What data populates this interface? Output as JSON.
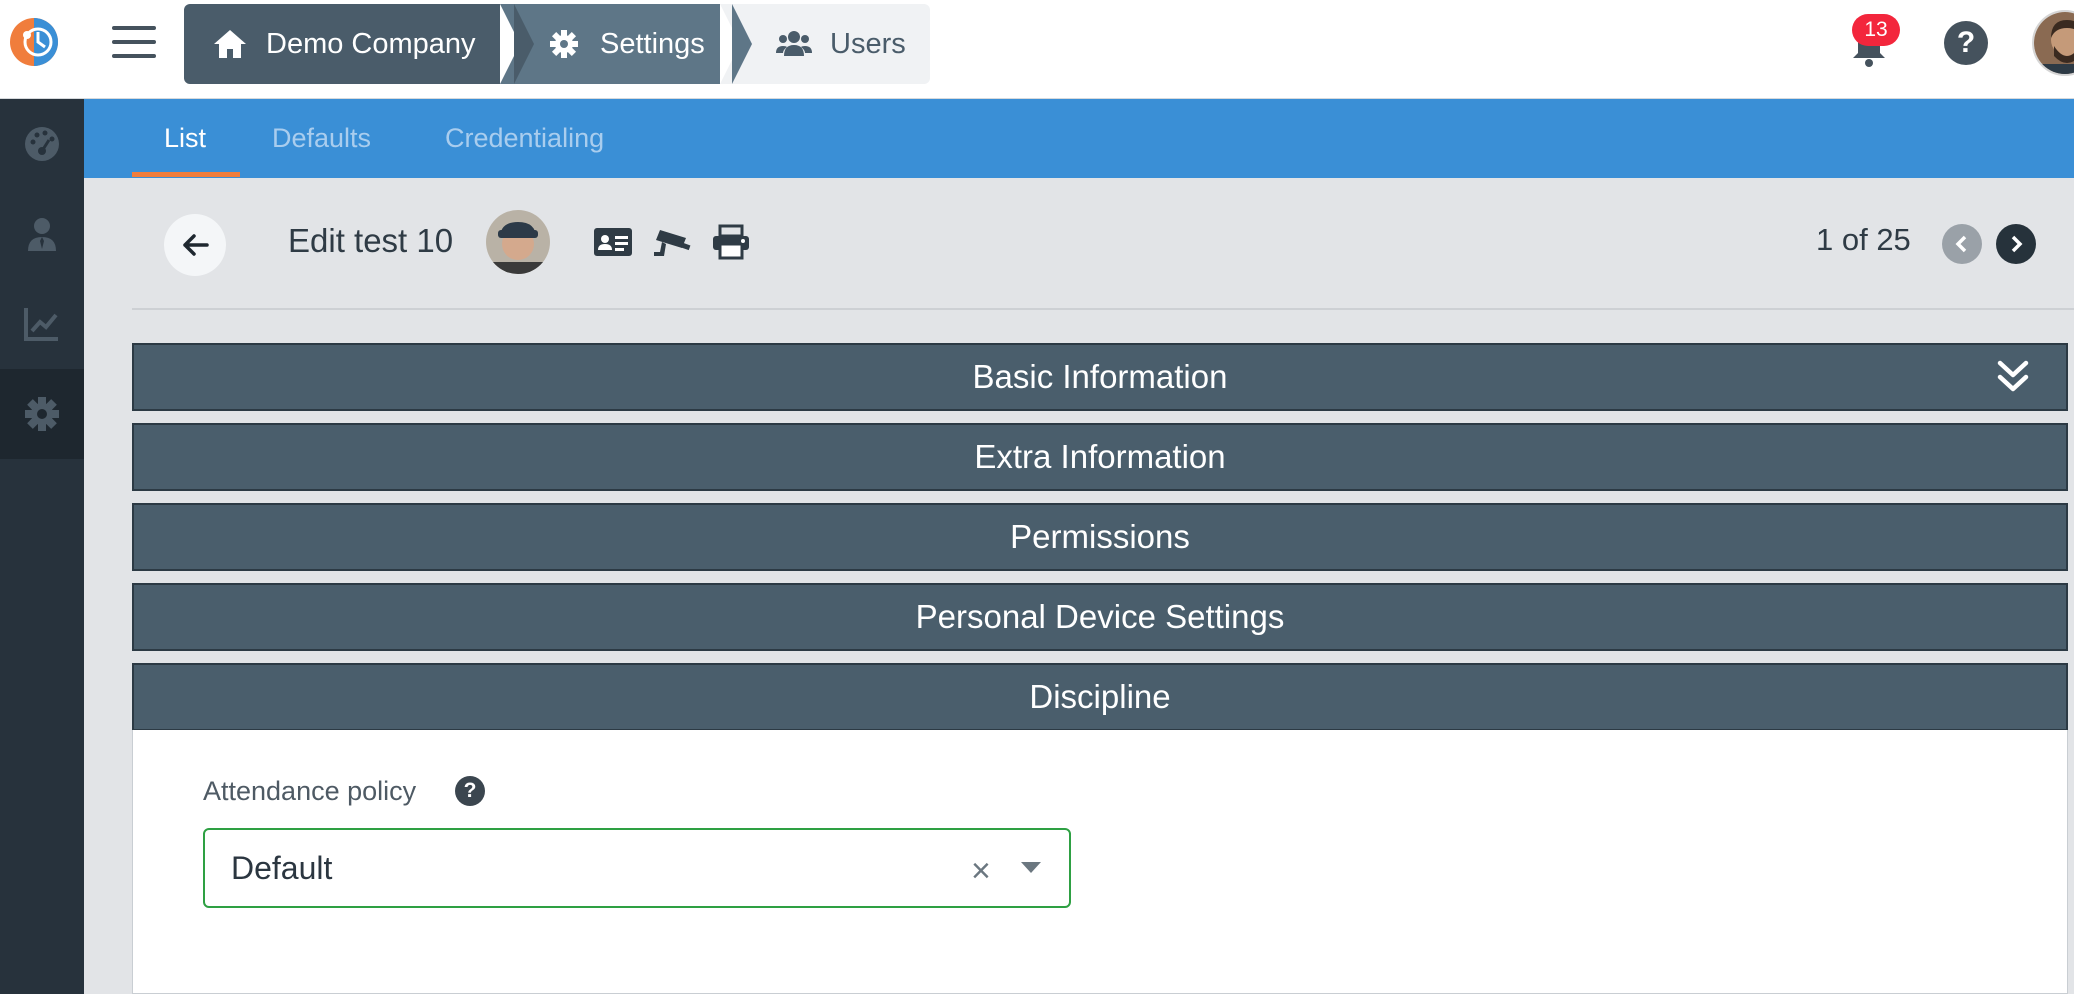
{
  "breadcrumb": [
    {
      "label": "Demo Company",
      "icon": "home-icon"
    },
    {
      "label": "Settings",
      "icon": "gear-icon"
    },
    {
      "label": "Users",
      "icon": "users-icon"
    }
  ],
  "notifications": {
    "count": "13"
  },
  "help": {
    "glyph": "?"
  },
  "sidebar": {
    "items": [
      {
        "icon": "dashboard-icon",
        "active": false
      },
      {
        "icon": "user-icon",
        "active": false
      },
      {
        "icon": "chart-line-icon",
        "active": false
      },
      {
        "icon": "gear-icon",
        "active": true
      }
    ]
  },
  "tabs": [
    {
      "label": "List",
      "active": true
    },
    {
      "label": "Defaults",
      "active": false
    },
    {
      "label": "Credentialing",
      "active": false
    }
  ],
  "record": {
    "title": "Edit test 10",
    "pager": "1 of 25"
  },
  "sections": [
    {
      "label": "Basic Information",
      "expanded_icon": "double-chevron-down-icon"
    },
    {
      "label": "Extra Information"
    },
    {
      "label": "Permissions"
    },
    {
      "label": "Personal Device Settings"
    },
    {
      "label": "Discipline"
    }
  ],
  "discipline": {
    "attendance_label": "Attendance policy",
    "attendance_value": "Default",
    "clear_glyph": "×"
  },
  "colors": {
    "accent_blue": "#3a8fd6",
    "active_tab_underline": "#f07d3c",
    "section_header": "#4a5e6c",
    "sidebar_bg": "#27323c",
    "badge_red": "#f3263c",
    "select_border": "#2ea043"
  }
}
